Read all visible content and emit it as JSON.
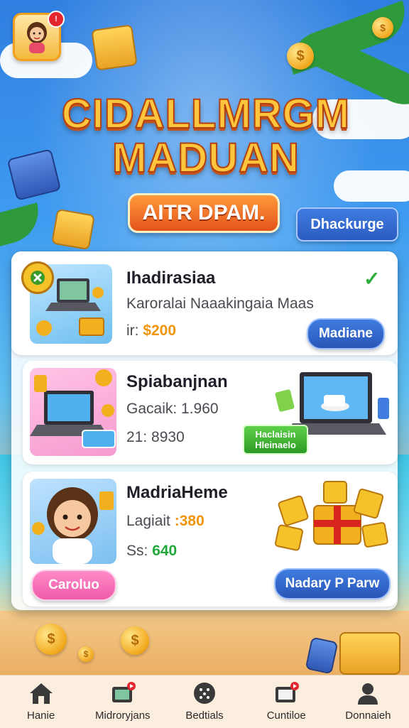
{
  "header": {
    "title_line1": "CIDALLMRGM",
    "title_line2": "MADUAN",
    "subtitle": "AITR DPAM.",
    "top_action_label": "Dhackurge",
    "notification_count": "!"
  },
  "offers": [
    {
      "title": "Ihadirasiaa",
      "line1": "Karoralai Naaakingaia Maas",
      "line2_prefix": "ir: ",
      "line2_value": "$200",
      "button_label": "Madiane",
      "completed_mark": "✓"
    },
    {
      "title": "Spiabanjnan",
      "line1": "Gacaik: 1.960",
      "line2": "21: 8930",
      "tag_line1": "Haclaisin",
      "tag_line2": "Hleinaelo"
    },
    {
      "title": "MadriaHeme",
      "line1_prefix": "Lagiait ",
      "line1_value": ":380",
      "line2_prefix": "Ss: ",
      "line2_value": "640",
      "left_button_label": "Caroluo",
      "right_button_label": "Nadary P Parw"
    }
  ],
  "bottom_nav": [
    {
      "label": "Hanie",
      "icon": "home-icon"
    },
    {
      "label": "Midroryjans",
      "icon": "video-icon"
    },
    {
      "label": "Bedtials",
      "icon": "dice-icon"
    },
    {
      "label": "Cuntiloe",
      "icon": "tv-icon"
    },
    {
      "label": "Donnaieh",
      "icon": "person-icon"
    }
  ],
  "colors": {
    "accent_blue": "#2b5bc0",
    "accent_orange": "#f0940a",
    "accent_green": "#22a83a",
    "accent_pink": "#f05aa8"
  }
}
